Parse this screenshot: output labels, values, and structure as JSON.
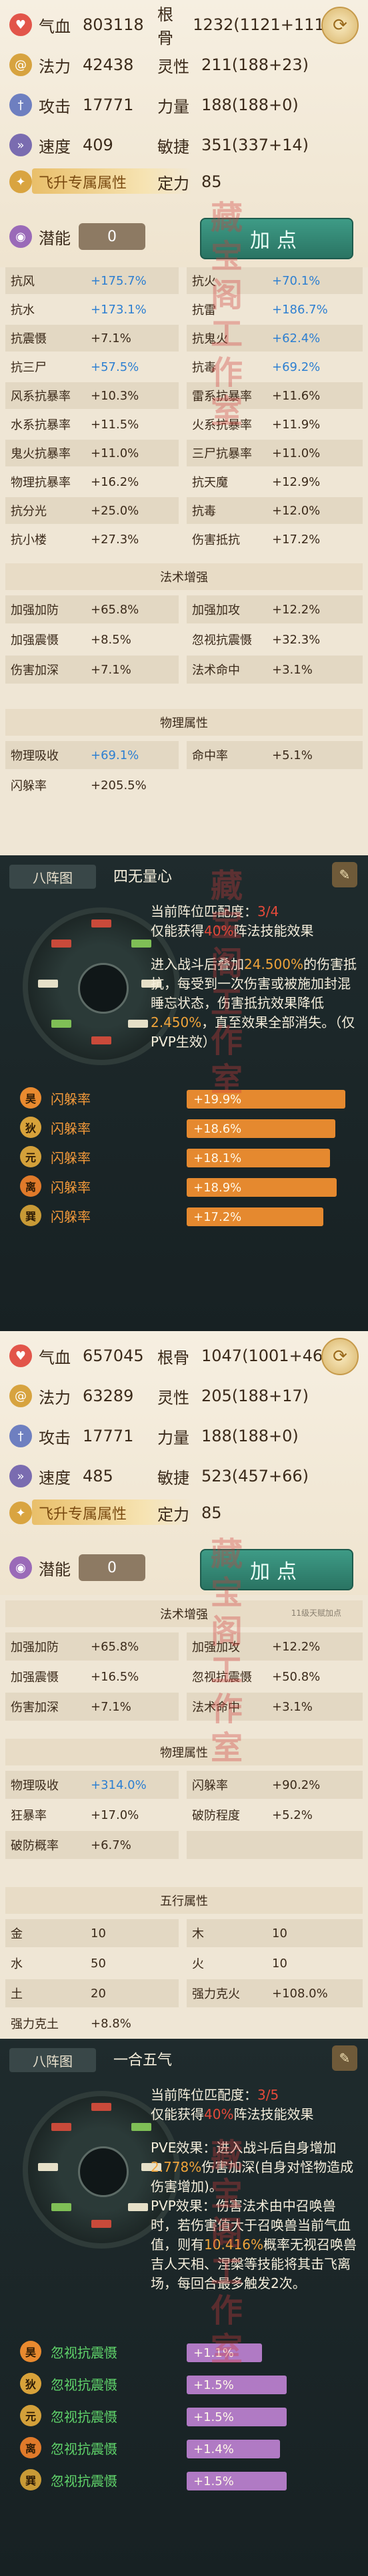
{
  "watermark": "藏宝阁工作室",
  "role1": {
    "stats_left": [
      {
        "label": "气血",
        "value": "803118",
        "icon": "heart-icon",
        "color": "#e2554a"
      },
      {
        "label": "法力",
        "value": "42438",
        "icon": "mana-swirl-icon",
        "color": "#d7a33f"
      },
      {
        "label": "攻击",
        "value": "17771",
        "icon": "sword-icon",
        "color": "#6e7fc0"
      },
      {
        "label": "速度",
        "value": "409",
        "icon": "boot-icon",
        "color": "#7a6cb0"
      }
    ],
    "stats_right": [
      {
        "label": "根骨",
        "value": "1232(1121+111)"
      },
      {
        "label": "灵性",
        "value": "211(188+23)"
      },
      {
        "label": "力量",
        "value": "188(188+0)"
      },
      {
        "label": "敏捷",
        "value": "351(337+14)"
      }
    ],
    "feisheng_label": "飞升专属属性",
    "dingli_label": "定力",
    "dingli_value": "85",
    "qianneng_label": "潜能",
    "qianneng_value": "0",
    "add_button": "加点",
    "resist": [
      [
        "抗风",
        "+175.7%",
        true,
        "抗火",
        "+70.1%",
        true
      ],
      [
        "抗水",
        "+173.1%",
        true,
        "抗雷",
        "+186.7%",
        true
      ],
      [
        "抗震慑",
        "+7.1%",
        false,
        "抗鬼火",
        "+62.4%",
        true
      ],
      [
        "抗三尸",
        "+57.5%",
        true,
        "抗毒",
        "+69.2%",
        true
      ],
      [
        "风系抗暴率",
        "+10.3%",
        false,
        "雷系抗暴率",
        "+11.6%",
        false
      ],
      [
        "水系抗暴率",
        "+11.5%",
        false,
        "火系抗暴率",
        "+11.9%",
        false
      ],
      [
        "鬼火抗暴率",
        "+11.0%",
        false,
        "三尸抗暴率",
        "+11.0%",
        false
      ],
      [
        "物理抗暴率",
        "+16.2%",
        false,
        "抗天魔",
        "+12.9%",
        false
      ],
      [
        "抗分光",
        "+25.0%",
        false,
        "抗毒",
        "+12.0%",
        false
      ],
      [
        "抗小楼",
        "+27.3%",
        false,
        "伤害抵抗",
        "+17.2%",
        false
      ]
    ],
    "fashu_title": "法术增强",
    "fashu": [
      [
        "加强加防",
        "+65.8%",
        false,
        "加强加攻",
        "+12.2%",
        false
      ],
      [
        "加强震慑",
        "+8.5%",
        false,
        "忽视抗震慑",
        "+32.3%",
        false
      ],
      [
        "伤害加深",
        "+7.1%",
        false,
        "法术命中",
        "+3.1%",
        false
      ]
    ],
    "wuli_title": "物理属性",
    "wuli": [
      [
        "物理吸收",
        "+69.1%",
        true,
        "命中率",
        "+5.1%",
        false
      ],
      [
        "闪躲率",
        "+205.5%",
        false,
        "",
        "",
        false
      ]
    ]
  },
  "zhen1": {
    "tab": "八阵图",
    "name": "四无量心",
    "match_prefix": "当前阵位匹配度：",
    "match_value": "3/4",
    "effect_prefix": "仅能获得",
    "effect_pct": "40%",
    "effect_suffix": "阵法技能效果",
    "desc1": "进入战斗后叠加",
    "desc_hl1": "24.500%",
    "desc2": "的伤害抵抗，每受到一次伤害或被施加封混睡忘状态，伤害抵抗效果降低",
    "desc_hl2": "2.450%",
    "desc3": "，直至效果全部消失。（仅PVP生效）",
    "rows": [
      {
        "badge": "昊",
        "label": "闪躲率",
        "value": "+19.9%",
        "fill": 0.95,
        "badge_color": "#e98a2f"
      },
      {
        "badge": "狄",
        "label": "闪躲率",
        "value": "+18.6%",
        "fill": 0.89,
        "badge_color": "#d8a23a"
      },
      {
        "badge": "元",
        "label": "闪躲率",
        "value": "+18.1%",
        "fill": 0.86,
        "badge_color": "#d3a03a"
      },
      {
        "badge": "离",
        "label": "闪躲率",
        "value": "+18.9%",
        "fill": 0.9,
        "badge_color": "#e07a2a"
      },
      {
        "badge": "巽",
        "label": "闪躲率",
        "value": "+17.2%",
        "fill": 0.82,
        "badge_color": "#c89a36"
      }
    ]
  },
  "role2": {
    "stats_left": [
      {
        "label": "气血",
        "value": "657045",
        "icon": "heart-icon",
        "color": "#e2554a"
      },
      {
        "label": "法力",
        "value": "63289",
        "icon": "mana-swirl-icon",
        "color": "#d7a33f"
      },
      {
        "label": "攻击",
        "value": "17771",
        "icon": "sword-icon",
        "color": "#6e7fc0"
      },
      {
        "label": "速度",
        "value": "485",
        "icon": "boot-icon",
        "color": "#7a6cb0"
      }
    ],
    "stats_right": [
      {
        "label": "根骨",
        "value": "1047(1001+46)"
      },
      {
        "label": "灵性",
        "value": "205(188+17)"
      },
      {
        "label": "力量",
        "value": "188(188+0)"
      },
      {
        "label": "敏捷",
        "value": "523(457+66)"
      }
    ],
    "feisheng_label": "飞升专属属性",
    "dingli_label": "定力",
    "dingli_value": "85",
    "qianneng_label": "潜能",
    "qianneng_value": "0",
    "add_button": "加点",
    "fashu_title": "法术增强",
    "fashu_note": "11级天赋加点",
    "fashu": [
      [
        "加强加防",
        "+65.8%",
        false,
        "加强加攻",
        "+12.2%",
        false
      ],
      [
        "加强震慑",
        "+16.5%",
        false,
        "忽视抗震慑",
        "+50.8%",
        false
      ],
      [
        "伤害加深",
        "+7.1%",
        false,
        "法术命中",
        "+3.1%",
        false
      ]
    ],
    "wuli_title": "物理属性",
    "wuli": [
      [
        "物理吸收",
        "+314.0%",
        true,
        "闪躲率",
        "+90.2%",
        false
      ],
      [
        "狂暴率",
        "+17.0%",
        false,
        "破防程度",
        "+5.2%",
        false
      ],
      [
        "破防概率",
        "+6.7%",
        false,
        "",
        "",
        false
      ]
    ],
    "wuxing_title": "五行属性",
    "wuxing": [
      [
        "金",
        "10",
        false,
        "木",
        "10",
        false
      ],
      [
        "水",
        "50",
        false,
        "火",
        "10",
        false
      ],
      [
        "土",
        "20",
        false,
        "强力克火",
        "+108.0%",
        false
      ],
      [
        "强力克土",
        "+8.8%",
        false,
        "",
        "",
        false
      ]
    ]
  },
  "zhen2": {
    "tab": "八阵图",
    "name": "一合五气",
    "match_prefix": "当前阵位匹配度：",
    "match_value": "3/5",
    "effect_prefix": "仅能获得",
    "effect_pct": "40%",
    "effect_suffix": "阵法技能效果",
    "pve1": "PVE效果：进入战斗后自身增加",
    "pve_hl": "2.778%",
    "pve2": "伤害加深(自身对怪物造成伤害增加)。",
    "pvp1": "PVP效果：伤害法术由中召唤兽时，若伤害值大于召唤兽当前气血值，则有",
    "pvp_hl": "10.416%",
    "pvp2": "概率无视召唤兽吉人天相、涅槃等技能将其击飞离场，每回合最多触发2次。",
    "rows": [
      {
        "badge": "昊",
        "label": "忽视抗震慑",
        "value": "+1.1%",
        "fill": 0.45,
        "badge_color": "#e98a2f"
      },
      {
        "badge": "狄",
        "label": "忽视抗震慑",
        "value": "+1.5%",
        "fill": 0.6,
        "badge_color": "#d8a23a"
      },
      {
        "badge": "元",
        "label": "忽视抗震慑",
        "value": "+1.5%",
        "fill": 0.6,
        "badge_color": "#d3a03a"
      },
      {
        "badge": "离",
        "label": "忽视抗震慑",
        "value": "+1.4%",
        "fill": 0.56,
        "badge_color": "#e07a2a"
      },
      {
        "badge": "巽",
        "label": "忽视抗震慑",
        "value": "+1.5%",
        "fill": 0.6,
        "badge_color": "#c89a36"
      }
    ]
  }
}
